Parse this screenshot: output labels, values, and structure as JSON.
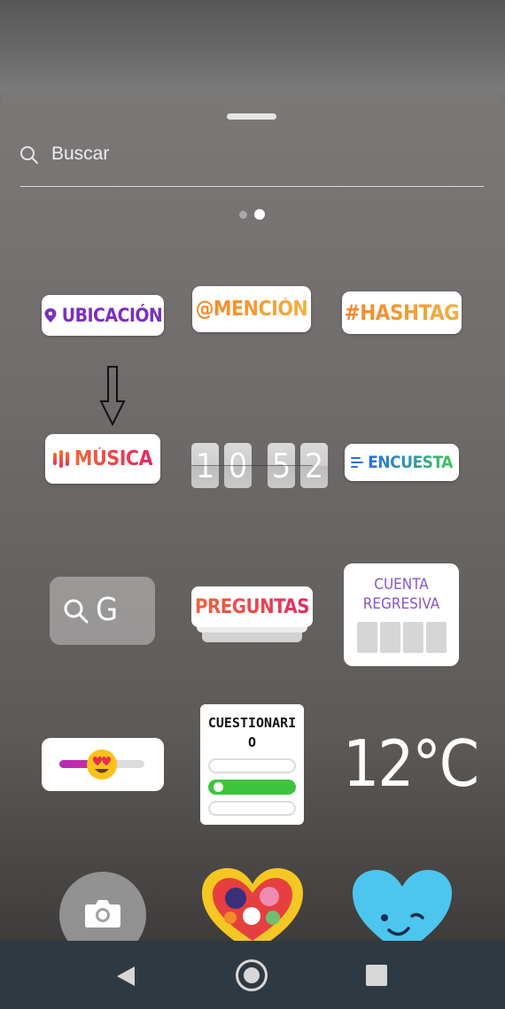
{
  "search": {
    "placeholder": "Buscar"
  },
  "pager": {
    "pages": 2,
    "active": 2
  },
  "stickers": {
    "location": "UBICACIÓN",
    "mention": "@MENCIÓN",
    "hashtag": "#HASHTAG",
    "music": "MÚSICA",
    "clock": [
      "1",
      "0",
      "5",
      "2"
    ],
    "poll": "ENCUESTA",
    "gif_search": "G",
    "questions": "PREGUNTAS",
    "countdown": "CUENTA\nREGRESIVA",
    "quiz": "CUESTIONARI\nO",
    "temperature": "12°C",
    "emoji_slider": {
      "value": 0.5,
      "emoji": "heart-eyes-emoji"
    }
  },
  "colors": {
    "location": "#7b2fbe",
    "questions_start": "#f0663a",
    "questions_end": "#e02b62",
    "countdown": "#8a56c9",
    "quiz_correct": "#3ec43e",
    "navbar": "#2f3941"
  },
  "icons": [
    "search-icon",
    "location-pin-icon",
    "music-bars-icon",
    "poll-lines-icon",
    "camera-icon",
    "back-triangle-icon",
    "home-circle-icon",
    "recents-square-icon",
    "down-arrow-annotation"
  ]
}
